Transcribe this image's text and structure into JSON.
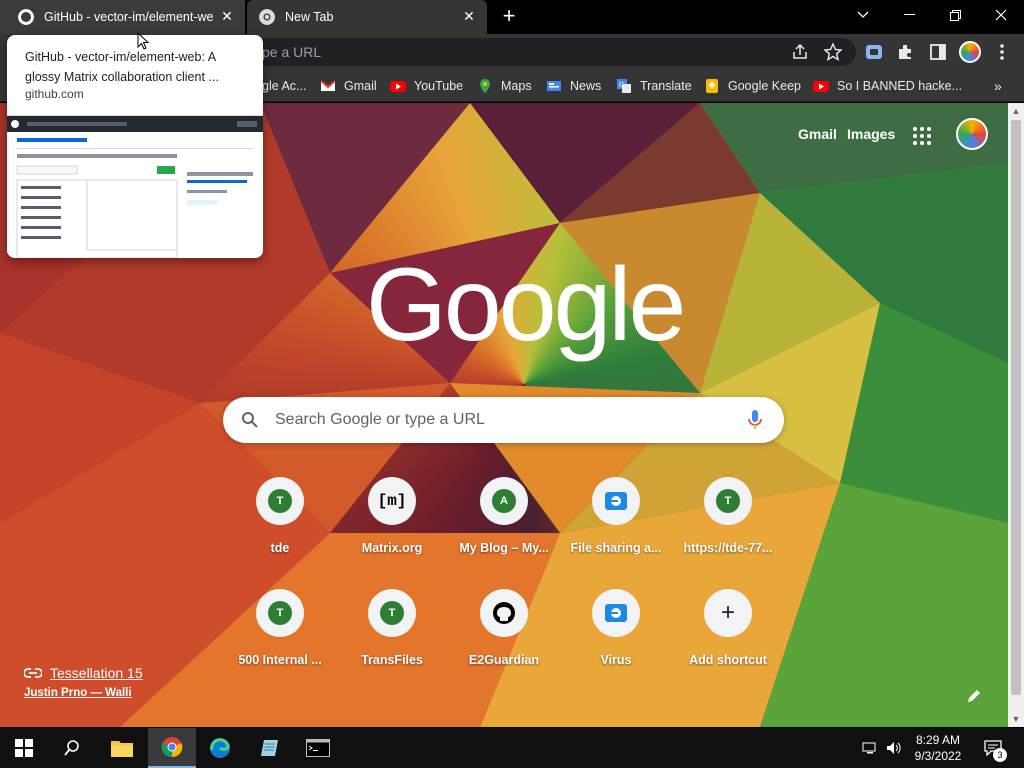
{
  "tabs": [
    {
      "title": "GitHub - vector-im/element-web",
      "active": false,
      "favicon": "github-icon"
    },
    {
      "title": "New Tab",
      "active": true,
      "favicon": "chrome-icon"
    }
  ],
  "omnibox": {
    "placeholder": "Search Google or type a URL",
    "visible_text": "pe a URL"
  },
  "bookmarks": [
    {
      "label": "gle Ac...",
      "icon": "google-icon"
    },
    {
      "label": "Gmail",
      "icon": "gmail-icon"
    },
    {
      "label": "YouTube",
      "icon": "youtube-icon"
    },
    {
      "label": "Maps",
      "icon": "maps-icon"
    },
    {
      "label": "News",
      "icon": "news-icon"
    },
    {
      "label": "Translate",
      "icon": "translate-icon"
    },
    {
      "label": "Google Keep",
      "icon": "keep-icon"
    },
    {
      "label": "So I BANNED hacke...",
      "icon": "youtube-icon"
    }
  ],
  "hovercard": {
    "title": "GitHub - vector-im/element-web: A glossy Matrix collaboration client ...",
    "domain": "github.com"
  },
  "ntp": {
    "gmail": "Gmail",
    "images": "Images",
    "logo": "Google",
    "search_placeholder": "Search Google or type a URL",
    "shortcuts": [
      {
        "label": "tde",
        "letter": "T",
        "color": "#2e7d32"
      },
      {
        "label": "Matrix.org",
        "letter": "[m]",
        "color": "#000000"
      },
      {
        "label": "My Blog – My...",
        "letter": "A",
        "color": "#2e7d32"
      },
      {
        "label": "File sharing a...",
        "letter": "",
        "color": "#1e88e5"
      },
      {
        "label": "https://tde-77...",
        "letter": "T",
        "color": "#2e7d32"
      },
      {
        "label": "500 Internal ...",
        "letter": "T",
        "color": "#2e7d32"
      },
      {
        "label": "TransFiles",
        "letter": "T",
        "color": "#2e7d32"
      },
      {
        "label": "E2Guardian",
        "letter": "",
        "color": "#000000"
      },
      {
        "label": "Virus",
        "letter": "",
        "color": "#1e88e5"
      },
      {
        "label": "Add shortcut",
        "letter": "+",
        "color": "#202124"
      }
    ],
    "attribution_title": "Tessellation 15",
    "attribution_author": "Justin Prno — Walli"
  },
  "taskbar": {
    "time": "8:29 AM",
    "date": "9/3/2022",
    "notifications": "3"
  }
}
